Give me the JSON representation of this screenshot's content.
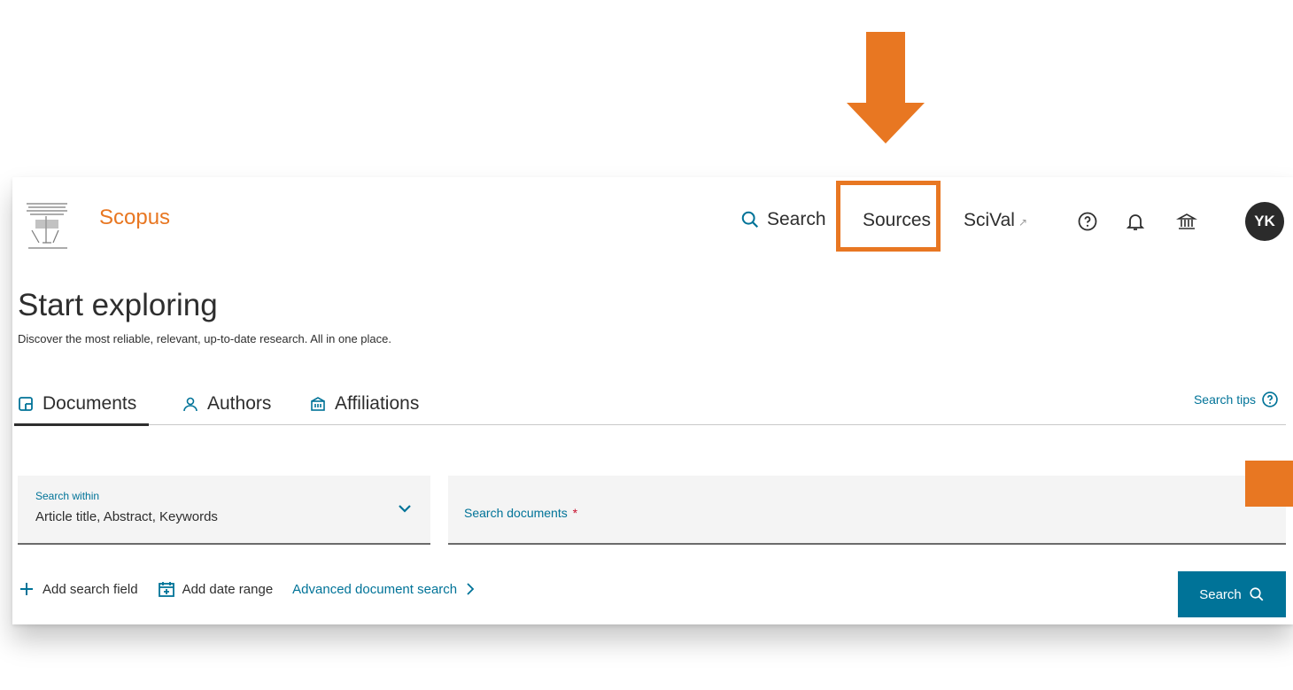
{
  "app": {
    "brand": "Scopus"
  },
  "nav": {
    "search_label": "Search",
    "sources_label": "Sources",
    "scival_label": "SciVal",
    "scival_ext": "↗",
    "avatar_initials": "YK"
  },
  "hero": {
    "title": "Start exploring",
    "subtitle": "Discover the most reliable, relevant, up-to-date research. All in one place."
  },
  "tabs": [
    {
      "label": "Documents",
      "icon": "document-icon",
      "active": true
    },
    {
      "label": "Authors",
      "icon": "person-icon",
      "active": false
    },
    {
      "label": "Affiliations",
      "icon": "building-icon",
      "active": false
    }
  ],
  "search_tips": "Search tips",
  "search_within": {
    "label": "Search within",
    "value": "Article title, Abstract, Keywords"
  },
  "search_documents": {
    "placeholder": "Search documents",
    "required_mark": "*"
  },
  "actions": {
    "add_field": "Add search field",
    "add_date": "Add date range",
    "advanced": "Advanced document search"
  },
  "search_button": "Search",
  "colors": {
    "accent": "#e87722",
    "link": "#007398",
    "button": "#007398"
  }
}
